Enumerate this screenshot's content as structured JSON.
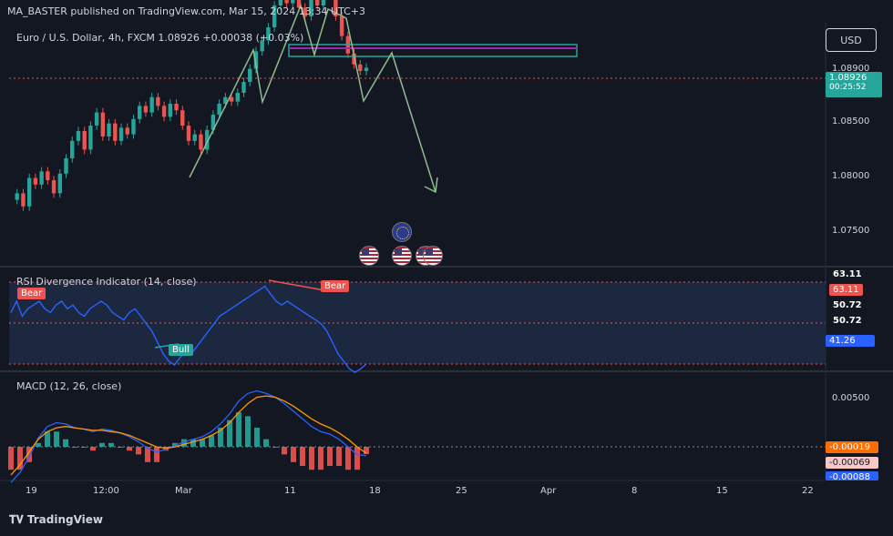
{
  "header": {
    "published": "MA_BASTER published on TradingView.com, Mar 15, 2024 13:34 UTC+3"
  },
  "currency_button": "USD",
  "brand": "TradingView",
  "colors": {
    "bull": "#26a69a",
    "bear": "#ef5350",
    "rsi": "#2962ff",
    "macd": "#2962ff",
    "signal": "#ff9800",
    "zone": "#9c27b0",
    "projection": "#8fbc8f"
  },
  "price_pane": {
    "legend": "Euro / U.S. Dollar, 4h, FXCM  1.08926  +0.00038 (+0.03%)",
    "last_price": "1.08926",
    "countdown": "00:25:52",
    "price_labels": [
      "1.08900",
      "1.08500",
      "1.08000",
      "1.07500"
    ],
    "events": [
      {
        "icon": "eu-flag-icon"
      },
      {
        "icon": "us-flag-icon"
      },
      {
        "icon": "us-flag-icon"
      },
      {
        "icon": "us-flag-icon"
      },
      {
        "icon": "us-flag-icon"
      }
    ]
  },
  "rsi_pane": {
    "legend": "RSI Divergence Indicator (14, close)",
    "labels": [
      "63.11",
      "63.11",
      "50.72",
      "50.72",
      "41.26"
    ],
    "signals": [
      "Bear",
      "Bull",
      "Bear"
    ]
  },
  "macd_pane": {
    "legend": "MACD (12, 26, close)",
    "labels": [
      "0.00500",
      "-0.00019",
      "-0.00069",
      "-0.00088"
    ]
  },
  "time_axis": [
    "19",
    "12:00",
    "Mar",
    "11",
    "18",
    "25",
    "Apr",
    "8",
    "15",
    "22"
  ],
  "chart_data": {
    "type": "line",
    "title": "Euro / U.S. Dollar, 4h, FXCM",
    "x": [
      "19",
      "12:00",
      "Mar",
      "11",
      "18",
      "25",
      "Apr",
      "8",
      "15",
      "22"
    ],
    "price_ticks": [
      1.089,
      1.085,
      1.08,
      1.075
    ],
    "price_series": [
      1.0772,
      1.0778,
      1.0766,
      1.0792,
      1.0786,
      1.0798,
      1.079,
      1.0778,
      1.0796,
      1.081,
      1.0826,
      1.0835,
      1.0818,
      1.084,
      1.0852,
      1.083,
      1.0842,
      1.0826,
      1.0838,
      1.0832,
      1.0846,
      1.0858,
      1.0852,
      1.0866,
      1.0858,
      1.0848,
      1.086,
      1.0854,
      1.084,
      1.0826,
      1.0832,
      1.0818,
      1.0836,
      1.085,
      1.086,
      1.0866,
      1.0862,
      1.087,
      1.088,
      1.0892,
      1.0908,
      1.0918,
      1.093,
      1.095,
      1.0962,
      1.0952,
      1.0956,
      1.0948,
      1.094,
      1.0956,
      1.095,
      1.096,
      1.0962,
      1.094,
      1.0922,
      1.0906,
      1.0896,
      1.089,
      1.0893
    ],
    "last_price": 1.08926,
    "last_change": 0.00038,
    "last_change_pct": 0.03,
    "resistance_zone": [
      1.0932,
      1.0943
    ],
    "projection": [
      1.0898,
      1.0937,
      1.0812
    ],
    "rsi": {
      "series": [
        55,
        58,
        54,
        56,
        57,
        58,
        56,
        55,
        57,
        58,
        56,
        57,
        55,
        54,
        56,
        57,
        58,
        57,
        55,
        54,
        53,
        55,
        56,
        54,
        52,
        50,
        47,
        44,
        42,
        41,
        43,
        45,
        44,
        46,
        48,
        50,
        52,
        54,
        55,
        56,
        57,
        58,
        59,
        60,
        61,
        62,
        60,
        58,
        57,
        58,
        57,
        56,
        55,
        54,
        53,
        52,
        50,
        47,
        44,
        42,
        40,
        39,
        40,
        41.26
      ],
      "levels": [
        63.11,
        50.72,
        41.26
      ],
      "signals": [
        "Bear",
        "Bull",
        "Bear"
      ]
    },
    "macd": {
      "series": [
        -0.003,
        -0.0022,
        -0.001,
        0.0005,
        0.0014,
        0.0017,
        0.0016,
        0.0013,
        0.0012,
        0.001,
        0.0012,
        0.0011,
        0.0009,
        0.0006,
        0.0002,
        -0.0003,
        -0.0006,
        -0.0004,
        -0.0001,
        0.0002,
        0.0004,
        0.0006,
        0.001,
        0.0016,
        0.0024,
        0.0034,
        0.004,
        0.0042,
        0.004,
        0.0037,
        0.0032,
        0.0026,
        0.002,
        0.0014,
        0.001,
        0.0008,
        0.0004,
        -0.0002,
        -0.0008,
        -0.00088
      ],
      "signal": [
        -0.0024,
        -0.0016,
        -0.0006,
        0.0004,
        0.001,
        0.0013,
        0.0014,
        0.0013,
        0.0012,
        0.0011,
        0.0011,
        0.001,
        0.0009,
        0.0007,
        0.0004,
        0.0001,
        -0.0002,
        -0.0003,
        -0.0002,
        0.0,
        0.0002,
        0.0004,
        0.0007,
        0.0011,
        0.0017,
        0.0025,
        0.0032,
        0.0037,
        0.0038,
        0.0037,
        0.0034,
        0.003,
        0.0025,
        0.002,
        0.0016,
        0.0013,
        0.0009,
        0.0004,
        -0.0002,
        -0.00069
      ],
      "zero": -0.00019,
      "ticks": [
        0.005
      ]
    }
  }
}
